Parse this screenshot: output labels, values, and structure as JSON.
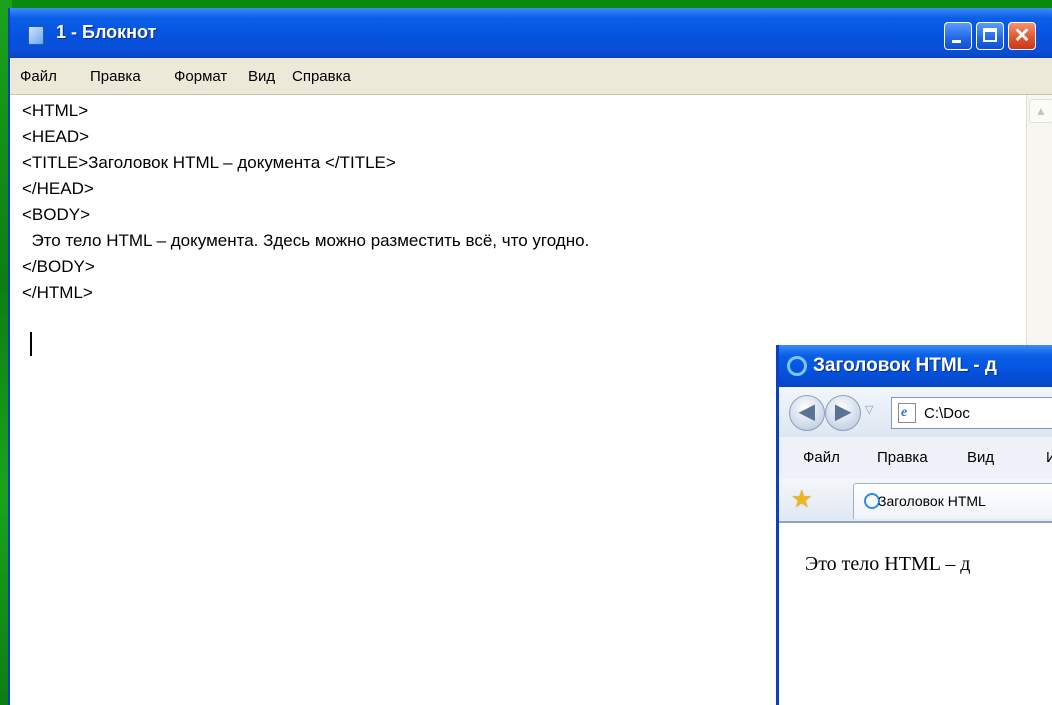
{
  "notepad": {
    "title": "1 - Блокнот",
    "menu": [
      "Файл",
      "Правка",
      "Формат",
      "Вид",
      "Справка"
    ],
    "lines": [
      "<HTML>",
      "<HEAD>",
      "<TITLE>Заголовок HTML – документа </TITLE>",
      "</HEAD>",
      "<BODY>",
      "  Это тело HTML – документа. Здесь можно разместить всё, что угодно.",
      "</BODY>",
      "</HTML>"
    ],
    "scroll_up_glyph": "▲"
  },
  "browser": {
    "title": "Заголовок HTML - д",
    "address": "C:\\Doc",
    "menu": [
      "Файл",
      "Правка",
      "Вид",
      "И"
    ],
    "tab_label": "Заголовок HTML",
    "body_text": "Это тело HTML – д",
    "back_glyph": "◀",
    "forward_glyph": "▶",
    "dropdown_glyph": "▽",
    "favorites_glyph": "★",
    "page_icon_glyph": "e"
  },
  "colors": {
    "desktop": "#0b8a12",
    "titlebar": "#0553df",
    "menubar": "#ece9d8",
    "close_button": "#e0512a"
  },
  "icons": [
    "notepad-app-icon",
    "minimize-icon",
    "maximize-icon",
    "close-icon",
    "ie-logo-icon",
    "back-arrow-icon",
    "forward-arrow-icon",
    "ie-page-icon",
    "favorites-star-icon"
  ]
}
